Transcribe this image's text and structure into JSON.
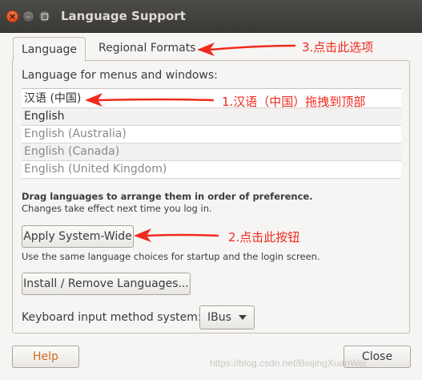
{
  "window": {
    "title": "Language Support"
  },
  "tabs": [
    {
      "label": "Language",
      "active": true
    },
    {
      "label": "Regional Formats",
      "active": false
    }
  ],
  "language_tab": {
    "list_label": "Language for menus and windows:",
    "languages": [
      {
        "label": "汉语 (中国)",
        "state": "active"
      },
      {
        "label": "English",
        "state": "active"
      },
      {
        "label": "English (Australia)",
        "state": "inactive"
      },
      {
        "label": "English (Canada)",
        "state": "inactive"
      },
      {
        "label": "English (United Kingdom)",
        "state": "inactive"
      }
    ],
    "drag_hint": "Drag languages to arrange them in order of preference.",
    "change_hint": "Changes take effect next time you log in.",
    "apply_button": "Apply System-Wide",
    "apply_hint": "Use the same language choices for startup and the login screen.",
    "install_button": "Install / Remove Languages...",
    "keyboard_label": "Keyboard input method system:",
    "keyboard_value": "IBus"
  },
  "footer": {
    "help_button": "Help",
    "close_button": "Close"
  },
  "annotations": {
    "step1": "1.汉语（中国）拖拽到顶部",
    "step2": "2.点击此按钮",
    "step3": "3.点击此选项",
    "color": "#f02a1d"
  },
  "watermark": "https://blog.csdn.net/BeijingXuanWei"
}
